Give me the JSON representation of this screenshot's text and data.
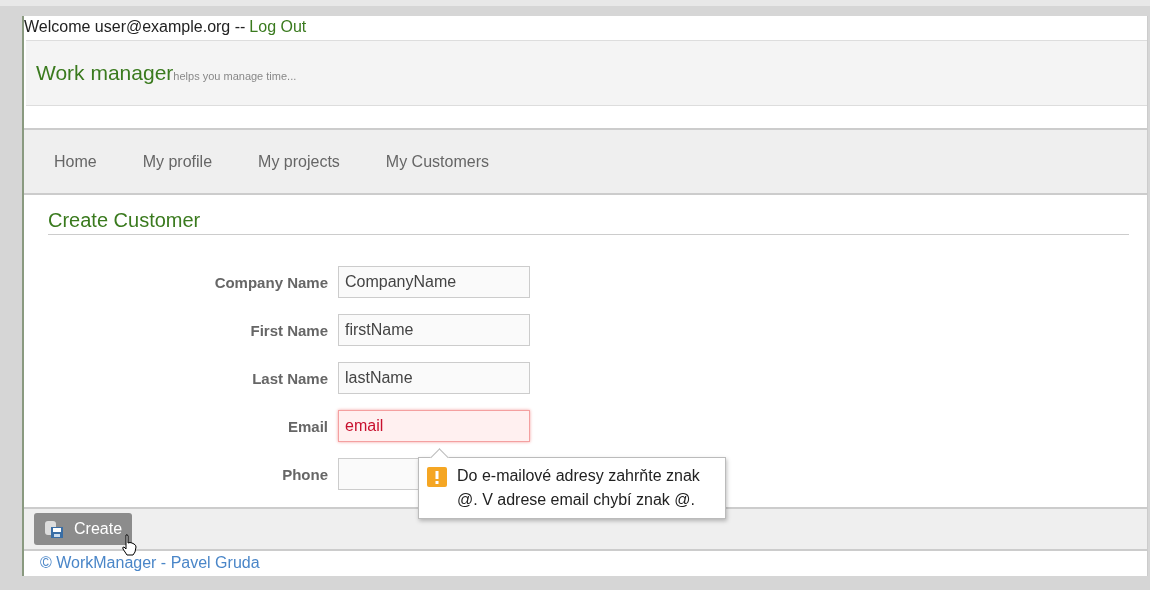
{
  "top_bar": {
    "welcome": "Welcome user@example.org --",
    "logout": "Log Out"
  },
  "header": {
    "title": "Work manager",
    "tagline": "helps you manage time..."
  },
  "nav": [
    {
      "label": "Home"
    },
    {
      "label": "My profile"
    },
    {
      "label": "My projects"
    },
    {
      "label": "My Customers"
    }
  ],
  "form": {
    "title": "Create Customer",
    "fields": [
      {
        "label": "Company Name",
        "value": "CompanyName",
        "invalid": false
      },
      {
        "label": "First Name",
        "value": "firstName",
        "invalid": false
      },
      {
        "label": "Last Name",
        "value": "lastName",
        "invalid": false
      },
      {
        "label": "Email",
        "value": "email",
        "invalid": true
      },
      {
        "label": "Phone",
        "invalid": false
      }
    ],
    "tooltip": "Do e-mailové adresy zahrňte znak @. V adrese email chybí znak @."
  },
  "actions": {
    "create": "Create"
  },
  "footer": "© WorkManager - Pavel Gruda"
}
